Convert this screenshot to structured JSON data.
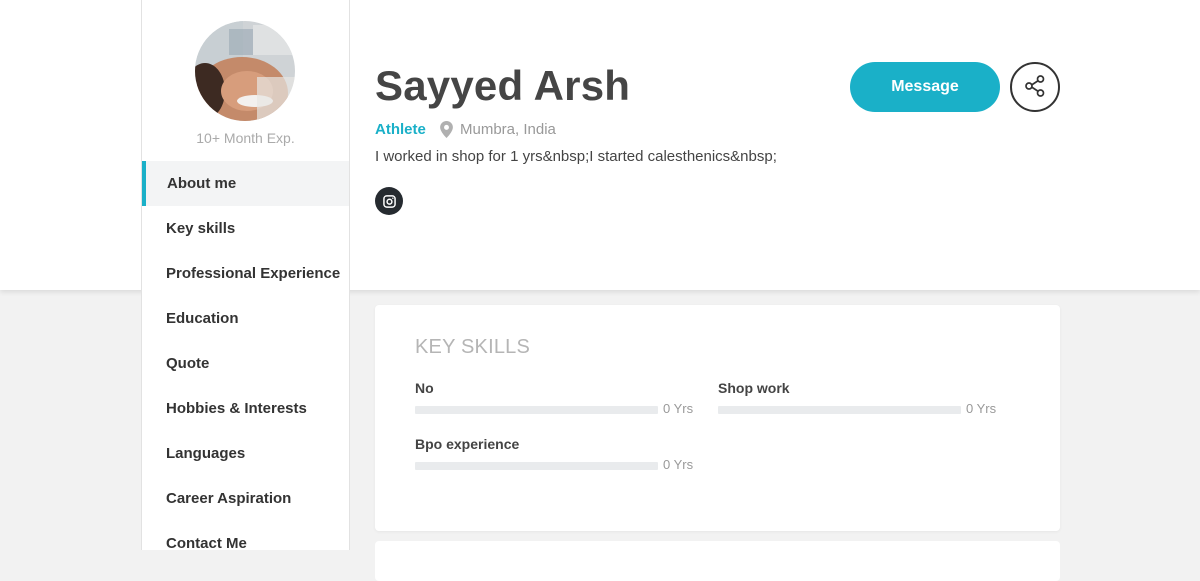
{
  "profile": {
    "experience": "10+ Month Exp.",
    "name": "Sayyed Arsh",
    "role": "Athlete",
    "location": "Mumbra, India",
    "bio": "I worked in shop for 1 yrs&nbsp;I started calesthenics&nbsp;",
    "social_icon": "instagram-icon"
  },
  "actions": {
    "message_label": "Message",
    "share_icon": "share-icon"
  },
  "sidebar": {
    "items": [
      {
        "label": "About me",
        "active": true
      },
      {
        "label": "Key skills"
      },
      {
        "label": "Professional Experience"
      },
      {
        "label": "Education"
      },
      {
        "label": "Quote"
      },
      {
        "label": "Hobbies & Interests"
      },
      {
        "label": "Languages"
      },
      {
        "label": "Career Aspiration"
      },
      {
        "label": "Contact Me"
      }
    ]
  },
  "key_skills": {
    "title": "KEY SKILLS",
    "skills": [
      {
        "name": "No",
        "years": "0 Yrs",
        "level": 0
      },
      {
        "name": "Shop work",
        "years": "0 Yrs",
        "level": 0
      },
      {
        "name": "Bpo experience",
        "years": "0 Yrs",
        "level": 0
      }
    ]
  },
  "colors": {
    "accent": "#1ab0c8",
    "text_dark": "#454545",
    "muted": "#999999",
    "page_bg": "#f2f2f2"
  }
}
